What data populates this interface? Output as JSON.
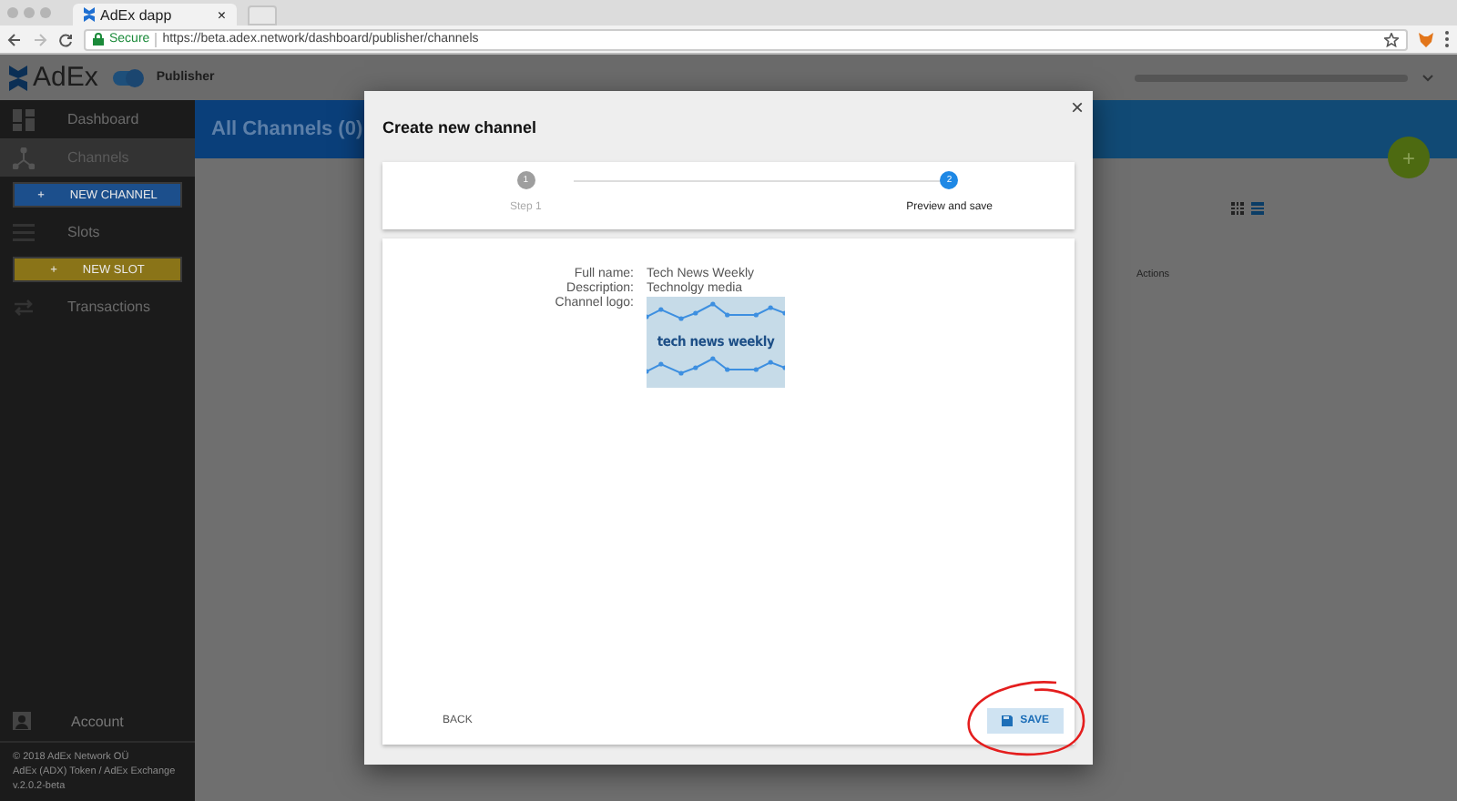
{
  "browser": {
    "tab_title": "AdEx dapp",
    "tab_close": "×",
    "secure_label": "Secure",
    "url": "https://beta.adex.network/dashboard/publisher/channels"
  },
  "header": {
    "brand": "AdEx",
    "mode_toggle": {
      "on": true
    },
    "mode_label": "Publisher"
  },
  "sidebar": {
    "items": [
      {
        "kind": "link",
        "label": "Dashboard",
        "selected": false
      },
      {
        "kind": "link",
        "label": "Channels",
        "selected": true
      },
      {
        "kind": "action",
        "plus": "+",
        "label": "NEW CHANNEL",
        "color": "#1c4f8c"
      },
      {
        "kind": "link",
        "label": "Slots",
        "selected": false
      },
      {
        "kind": "action",
        "plus": "+",
        "label": "NEW SLOT",
        "color": "#8a7418"
      },
      {
        "kind": "link",
        "label": "Transactions",
        "selected": false
      }
    ],
    "account": "Account",
    "footer": [
      "© 2018 AdEx Network OÜ",
      "AdEx (ADX) Token / AdEx Exchange",
      "v.2.0.2-beta"
    ]
  },
  "main": {
    "title": "All Channels (0)",
    "fab": "+",
    "view_modes": [
      {
        "kind": "grid",
        "selected": false
      },
      {
        "kind": "list",
        "selected": true
      }
    ],
    "column_header": "Actions"
  },
  "modal": {
    "title": "Create new channel",
    "close": "×",
    "steps": [
      {
        "number": "1",
        "label": "Step 1",
        "selected": false
      },
      {
        "number": "2",
        "label": "Preview and save",
        "selected": true
      }
    ],
    "fields": [
      {
        "kind": "text",
        "label": "Full name:",
        "value": "Tech News Weekly"
      },
      {
        "kind": "text",
        "label": "Description:",
        "value": "Technolgy media"
      },
      {
        "kind": "image",
        "label": "Channel logo:",
        "logo_text": "tech news weekly"
      }
    ],
    "back": "BACK",
    "save": "SAVE"
  }
}
